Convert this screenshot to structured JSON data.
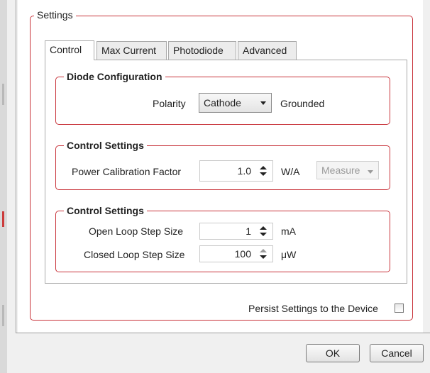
{
  "settings": {
    "group_title": "Settings",
    "tabs": [
      {
        "label": "Control",
        "active": true
      },
      {
        "label": "Max Current",
        "active": false
      },
      {
        "label": "Photodiode",
        "active": false
      },
      {
        "label": "Advanced",
        "active": false
      }
    ],
    "diode_config": {
      "title": "Diode Configuration",
      "polarity_label": "Polarity",
      "polarity_value": "Cathode",
      "grounded_label": "Grounded"
    },
    "control_settings_1": {
      "title": "Control Settings",
      "power_cal_label": "Power Calibration Factor",
      "power_cal_value": "1.0",
      "power_cal_unit": "W/A",
      "measure_value": "Measure"
    },
    "control_settings_2": {
      "title": "Control Settings",
      "open_loop_label": "Open Loop Step Size",
      "open_loop_value": "1",
      "open_loop_unit": "mA",
      "closed_loop_label": "Closed Loop Step Size",
      "closed_loop_value": "100",
      "closed_loop_unit": "μW"
    },
    "persist_label": "Persist Settings to the Device",
    "persist_checked": false
  },
  "buttons": {
    "ok_label": "OK",
    "cancel_label": "Cancel"
  },
  "colors": {
    "group_border": "#c8333a",
    "window_bg": "#f0f0f0"
  }
}
